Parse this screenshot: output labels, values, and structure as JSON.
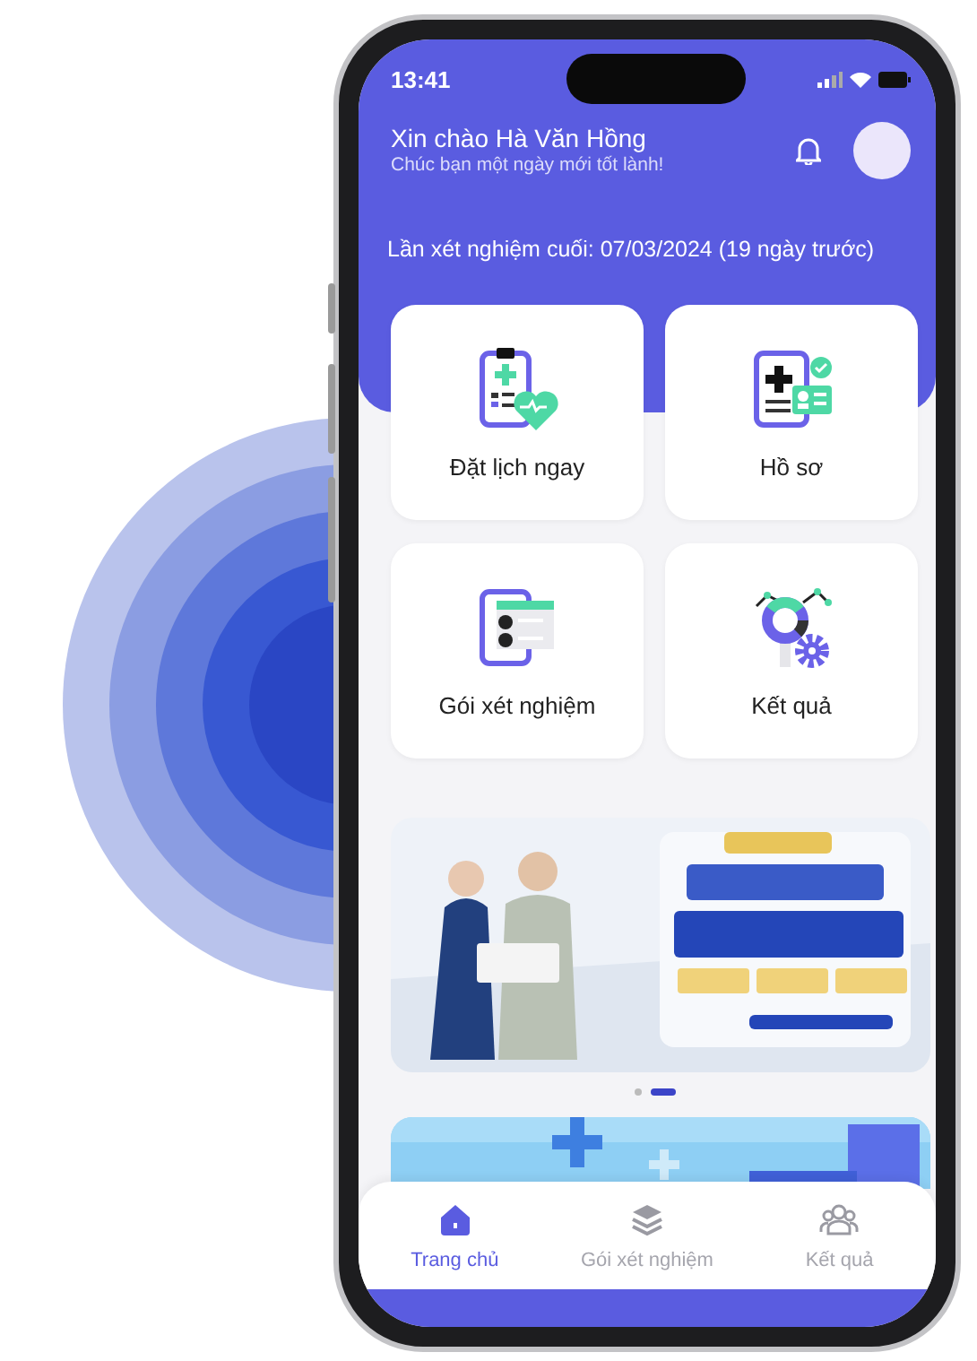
{
  "status_bar": {
    "time": "13:41"
  },
  "header": {
    "greeting": "Xin chào Hà Văn Hồng",
    "subtitle": "Chúc bạn một ngày mới tốt lành!"
  },
  "last_test": "Lần xét nghiệm cuối: 07/03/2024 (19 ngày trước)",
  "tiles": [
    {
      "label": "Đặt lịch ngay",
      "kind": "booking"
    },
    {
      "label": "Hồ sơ",
      "kind": "profile"
    },
    {
      "label": "Gói xét nghiệm",
      "kind": "package"
    },
    {
      "label": "Kết quả",
      "kind": "results"
    }
  ],
  "carousel_dots": [
    {
      "selected": false
    },
    {
      "selected": true
    }
  ],
  "bottom_nav": [
    {
      "label": "Trang chủ",
      "kind": "home",
      "selected": true
    },
    {
      "label": "Gói xét nghiệm",
      "kind": "layers",
      "selected": false
    },
    {
      "label": "Kết quả",
      "kind": "people",
      "selected": false
    }
  ]
}
